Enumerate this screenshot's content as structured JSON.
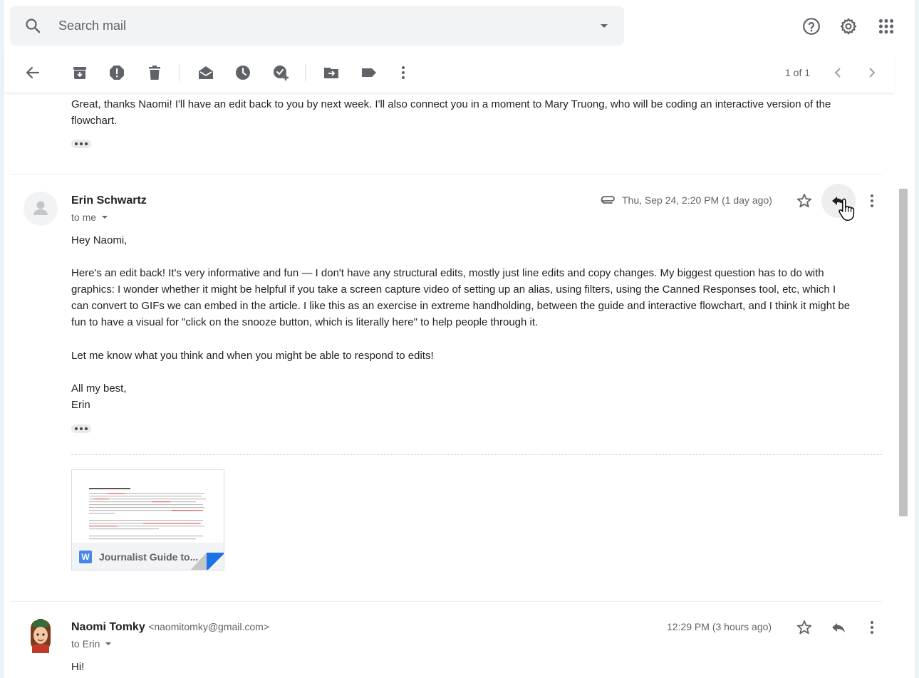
{
  "search": {
    "placeholder": "Search mail"
  },
  "header_icons": [
    "help-icon",
    "settings-gear-icon",
    "apps-grid-icon"
  ],
  "toolbar": {
    "buttons": [
      "back-arrow-icon",
      "archive-icon",
      "report-spam-icon",
      "delete-icon",
      "mark-unread-icon",
      "snooze-icon",
      "add-to-tasks-icon",
      "move-to-icon",
      "labels-icon",
      "more-vert-icon"
    ],
    "pager": "1 of 1"
  },
  "messages": {
    "prev": {
      "body": "Great, thanks Naomi! I'll have an edit back to you by next week. I'll also connect you in a moment to Mary Truong, who will be coding an interactive version of the flowchart."
    },
    "erin": {
      "sender": "Erin Schwartz",
      "to": "to me",
      "date": "Thu, Sep 24, 2:20 PM (1 day ago)",
      "greeting": "Hey Naomi,",
      "p1_l1": "Here's an edit back! It's very informative and fun — I don't have any structural edits, mostly just line edits and copy changes. My biggest question has to do with",
      "p1_l2": "graphics: I wonder whether it might be helpful if you take a screen capture video of setting up an alias, using filters, using the Canned Responses tool, etc, which I",
      "p1_l3": "can convert to GIFs we can embed in the article. I like this as an exercise in extreme handholding, between the guide and interactive flowchart, and I think it might be",
      "p1_l4": "fun to have a visual for \"click on the snooze button, which is literally here\" to help people through it.",
      "p2": "Let me know what you think and when you might be able to respond to edits!",
      "signoff": "All my best,",
      "signature": "Erin",
      "attachment": {
        "badge": "W",
        "name": "Journalist Guide to..."
      }
    },
    "naomi": {
      "sender": "Naomi Tomky",
      "email": "<naomitomky@gmail.com>",
      "to": "to Erin",
      "date": "12:29 PM (3 hours ago)",
      "body_start": "Hi!"
    }
  },
  "colors": {
    "accent_blue": "#1a73e8",
    "icon_gray": "#5f6368",
    "hover_bg": "#eeeeee"
  }
}
